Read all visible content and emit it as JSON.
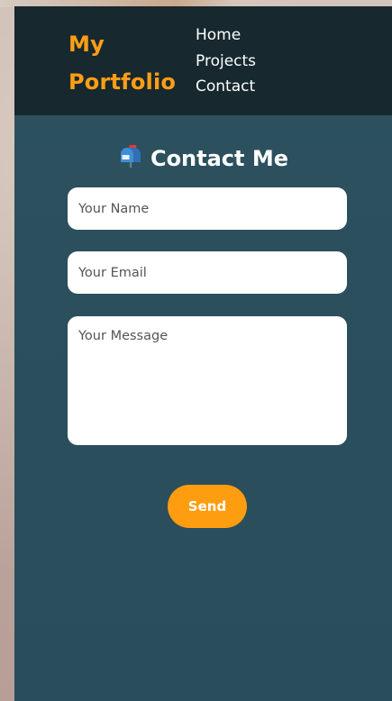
{
  "header": {
    "brand_line1": "My",
    "brand_line2": "Portfolio",
    "nav": [
      {
        "label": "Home"
      },
      {
        "label": "Projects"
      },
      {
        "label": "Contact"
      }
    ]
  },
  "contact": {
    "title": "Contact Me",
    "title_icon": "mailbox-icon",
    "name_placeholder": "Your Name",
    "email_placeholder": "Your Email",
    "message_placeholder": "Your Message",
    "send_label": "Send"
  },
  "colors": {
    "accent": "#ff9e16",
    "header_bg": "#17282f",
    "section_bg": "#2b4f5d",
    "field_bg": "#ffffff",
    "text_light": "#ffffff"
  }
}
